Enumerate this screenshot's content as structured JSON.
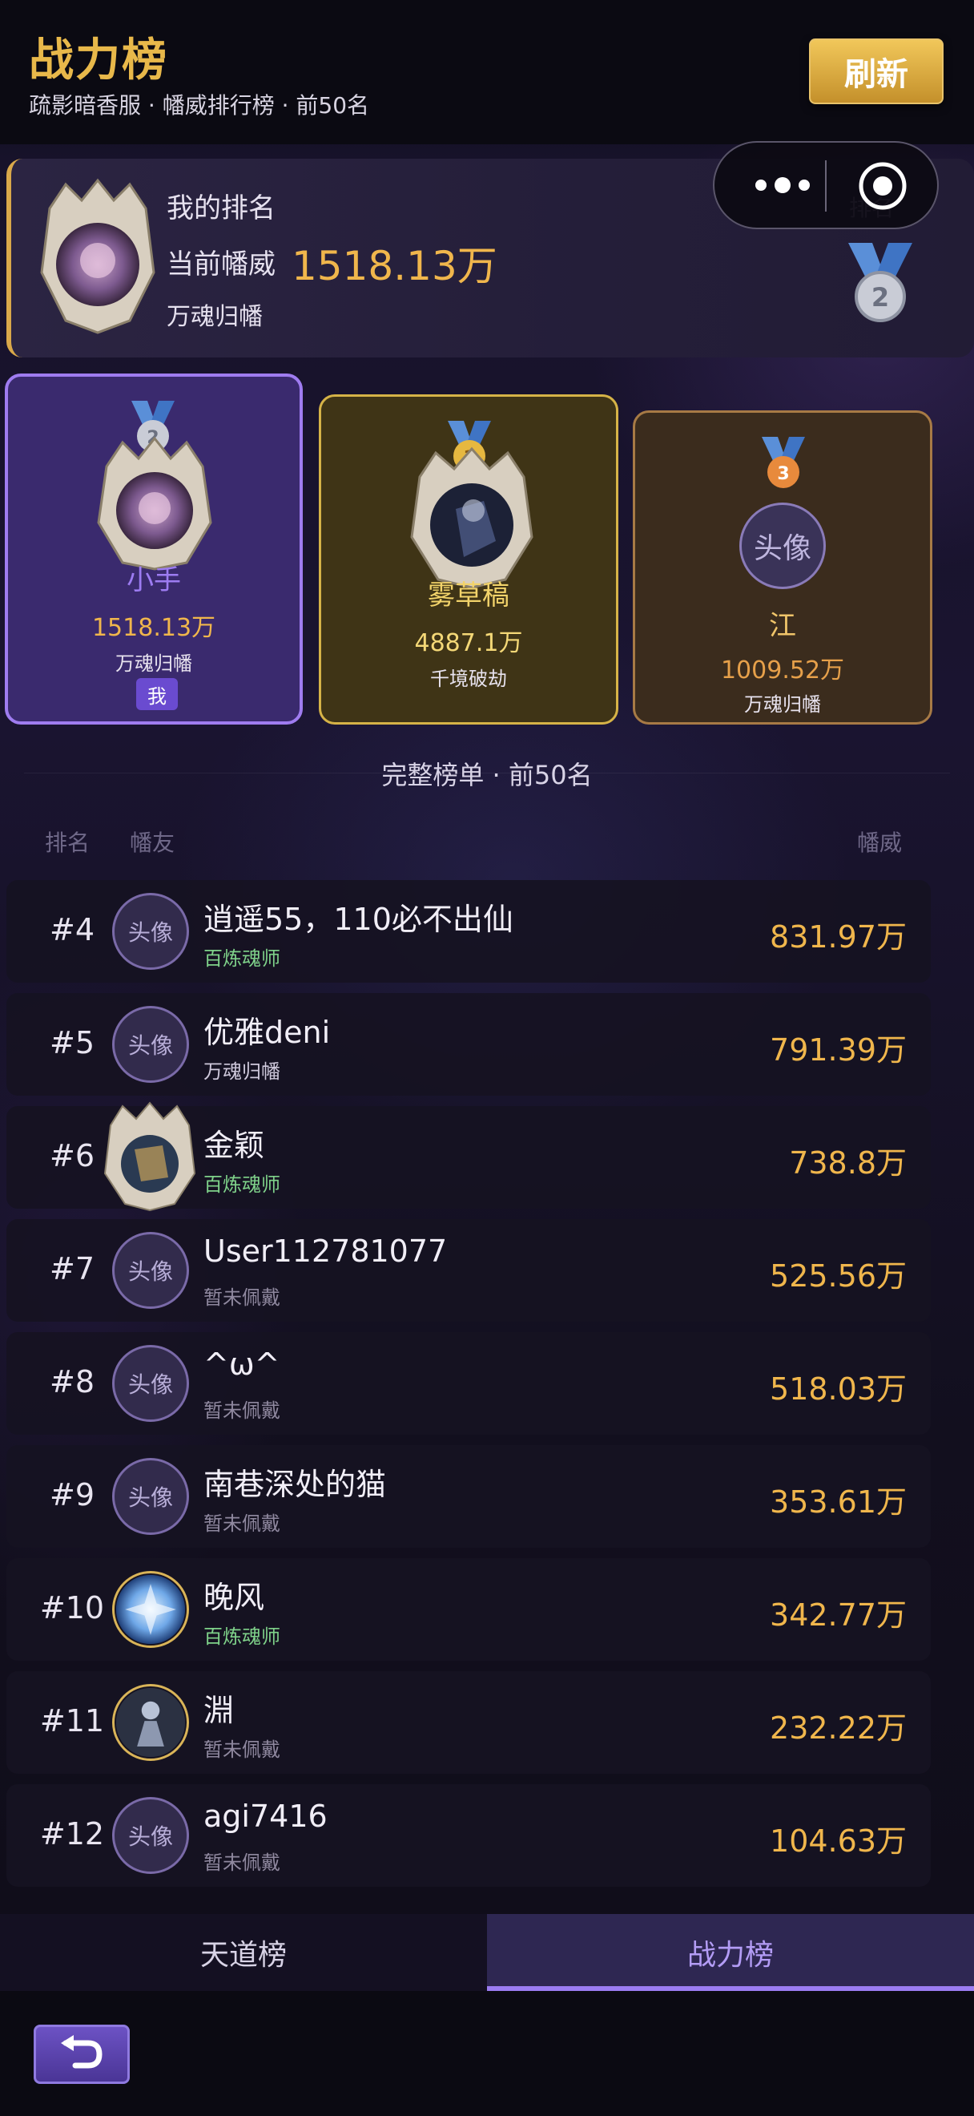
{
  "header": {
    "title": "战力榜",
    "subtitle": "疏影暗香服 · 幡威排行榜 · 前50名",
    "refresh_label": "刷新"
  },
  "my_rank": {
    "label": "我的排名",
    "power_label": "当前幡威",
    "power_value": "1518.13万",
    "title": "万魂归幡",
    "rank_label": "排名",
    "rank": "2"
  },
  "podium": [
    {
      "rank": "2",
      "name": "小手",
      "power": "1518.13万",
      "title": "万魂归幡",
      "me_badge": "我",
      "avatar": "image"
    },
    {
      "rank": "1",
      "name": "雾草稿",
      "power": "4887.1万",
      "title": "千境破劫",
      "avatar": "image"
    },
    {
      "rank": "3",
      "name": "江",
      "power": "1009.52万",
      "title": "万魂归幡",
      "avatar_text": "头像"
    }
  ],
  "section": {
    "title": "完整榜单 · 前50名",
    "col_rank": "排名",
    "col_member": "幡友",
    "col_power": "幡威"
  },
  "list": [
    {
      "rank": "#4",
      "name": "逍遥55，110必不出仙",
      "title": "百炼魂师",
      "power": "831.97万",
      "avatar_text": "头像"
    },
    {
      "rank": "#5",
      "name": "优雅deni",
      "title": "万魂归幡",
      "power": "791.39万",
      "avatar_text": "头像"
    },
    {
      "rank": "#6",
      "name": "金颖",
      "title": "百炼魂师",
      "power": "738.8万",
      "avatar_text": ""
    },
    {
      "rank": "#7",
      "name": "User112781077",
      "title": "暂未佩戴",
      "power": "525.56万",
      "avatar_text": "头像"
    },
    {
      "rank": "#8",
      "name": "^ω^",
      "title": "暂未佩戴",
      "power": "518.03万",
      "avatar_text": "头像"
    },
    {
      "rank": "#9",
      "name": "南巷深处的猫",
      "title": "暂未佩戴",
      "power": "353.61万",
      "avatar_text": "头像"
    },
    {
      "rank": "#10",
      "name": "晚风",
      "title": "百炼魂师",
      "power": "342.77万",
      "avatar_text": ""
    },
    {
      "rank": "#11",
      "name": "淵",
      "title": "暂未佩戴",
      "power": "232.22万",
      "avatar_text": ""
    },
    {
      "rank": "#12",
      "name": "agi7416",
      "title": "暂未佩戴",
      "power": "104.63万",
      "avatar_text": "头像"
    }
  ],
  "tabs": {
    "left": "天道榜",
    "right": "战力榜"
  },
  "colors": {
    "gold": "#f0b64c",
    "accent_purple": "#9b7cf2",
    "title_green": "#7fd28a"
  }
}
